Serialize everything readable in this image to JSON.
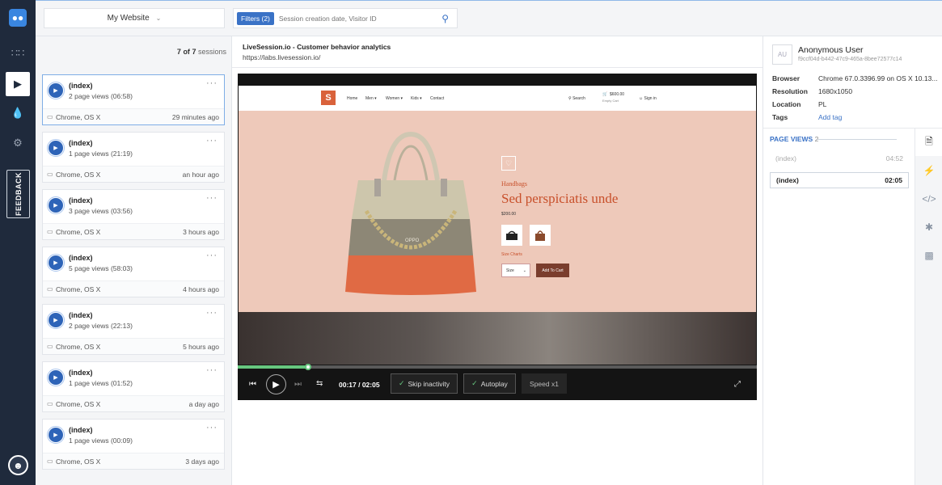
{
  "rail": {
    "feedback_label": "FEEDBACK",
    "icons": [
      "voicemail-icon",
      "grid-icon",
      "video-icon",
      "drop-icon",
      "gear-icon",
      "user-icon"
    ]
  },
  "topbar": {
    "website_label": "My Website",
    "filters_label": "Filters (2)",
    "search_placeholder": "Session creation date, Visitor ID"
  },
  "sessions": {
    "count_shown": "7",
    "count_of": "of",
    "count_total": "7",
    "count_suffix": "sessions",
    "items": [
      {
        "title": "(index)",
        "pageviews": "2 page views (06:58)",
        "browser": "Chrome, OS X",
        "ago": "29 minutes ago"
      },
      {
        "title": "(index)",
        "pageviews": "1 page views (21:19)",
        "browser": "Chrome, OS X",
        "ago": "an hour ago"
      },
      {
        "title": "(index)",
        "pageviews": "3 page views (03:56)",
        "browser": "Chrome, OS X",
        "ago": "3 hours ago"
      },
      {
        "title": "(index)",
        "pageviews": "5 page views (58:03)",
        "browser": "Chrome, OS X",
        "ago": "4 hours ago"
      },
      {
        "title": "(index)",
        "pageviews": "2 page views (22:13)",
        "browser": "Chrome, OS X",
        "ago": "5 hours ago"
      },
      {
        "title": "(index)",
        "pageviews": "1 page views (01:52)",
        "browser": "Chrome, OS X",
        "ago": "a day ago"
      },
      {
        "title": "(index)",
        "pageviews": "1 page views (00:09)",
        "browser": "Chrome, OS X",
        "ago": "3 days ago"
      }
    ]
  },
  "main": {
    "title": "LiveSession.io - Customer behavior analytics",
    "url": "https://labs.livesession.io/"
  },
  "recording": {
    "nav": [
      "Home",
      "Men ▾",
      "Women ▾",
      "Kids ▾",
      "Contact"
    ],
    "search": "Search",
    "cart_amount": "$600.00",
    "cart_sub": "Empty Cart",
    "signin": "Sign in",
    "category": "Handbags",
    "product_title": "Sed perspiciatis unde",
    "price": "$200.00",
    "size_charts": "Size Charts",
    "size_label": "Size",
    "add_to_cart": "Add To Cart",
    "bag_brand": "OPPO",
    "logo_letter": "S"
  },
  "player": {
    "progress": 0.136,
    "time": "00:17 / 02:05",
    "skip_inactivity": "Skip inactivity",
    "autoplay": "Autoplay",
    "speed": "Speed x1"
  },
  "user": {
    "initials": "AU",
    "name": "Anonymous User",
    "id": "f9ccf04d-b442-47c9-465a-8bee72577c14",
    "info": [
      {
        "key": "Browser",
        "value": "Chrome 67.0.3396.99 on OS X 10.13..."
      },
      {
        "key": "Resolution",
        "value": "1680x1050"
      },
      {
        "key": "Location",
        "value": "PL"
      },
      {
        "key": "Tags",
        "value": "Add tag"
      }
    ]
  },
  "pageviews": {
    "label": "PAGE VIEWS",
    "count": "2",
    "items": [
      {
        "title": "(index)",
        "time": "04:52"
      },
      {
        "title": "(index)",
        "time": "02:05"
      }
    ]
  },
  "colors": {
    "rail": "#1f2a3c",
    "accent": "#3a72c6",
    "progress": "#67c77f",
    "page_bg": "#eec9ba"
  }
}
